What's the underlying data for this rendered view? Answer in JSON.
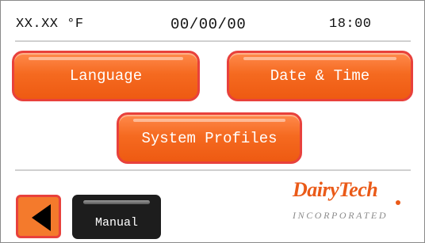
{
  "status_bar": {
    "temperature": "XX.XX °F",
    "date": "00/00/00",
    "time": "18:00"
  },
  "menu": {
    "language_label": "Language",
    "date_time_label": "Date & Time",
    "system_profiles_label": "System Profiles"
  },
  "footer": {
    "manual_label": "Manual",
    "back_icon": "left-triangle-arrow-icon"
  },
  "logo": {
    "brand": "DairyTech",
    "tagline": "INCORPORATED"
  },
  "colors": {
    "button_orange": "#f56a20",
    "button_border": "#e8413c",
    "manual_button": "#1d1d1d",
    "logo_orange": "#ea5a18"
  }
}
